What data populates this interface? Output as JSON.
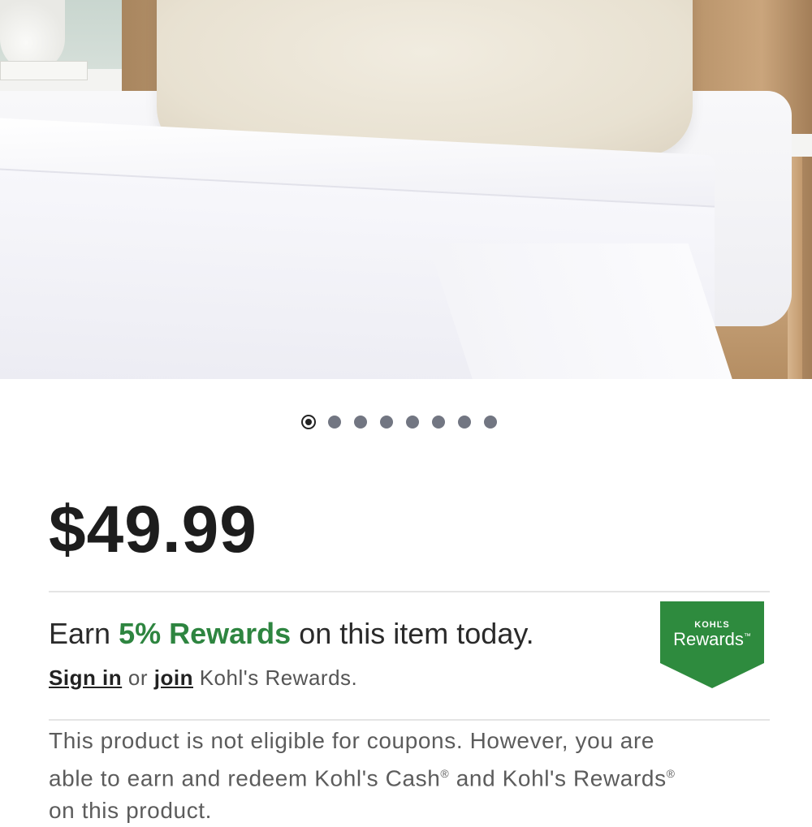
{
  "product": {
    "image_alt": "",
    "carousel": {
      "total": 8,
      "active_index": 0
    }
  },
  "price": {
    "current": "$49.99"
  },
  "rewards": {
    "earn_prefix": "Earn",
    "earn_highlight": "5% Rewards",
    "earn_suffix": "on this item today.",
    "sign_in_label": "Sign in",
    "or_text": "or",
    "join_label": "join",
    "program_text": "Kohl's Rewards.",
    "badge_brand": "KOHĽS",
    "badge_name": "Rewards",
    "badge_tm": "™"
  },
  "coupon_note": {
    "line1": "This product is not eligible for coupons. However, you are",
    "line2_prefix": "able to earn and redeem Kohl's Cash",
    "reg1": "®",
    "line2_mid": " and Kohl's Rewards",
    "reg2": "®",
    "line3": "on this product."
  },
  "colors": {
    "accent_green": "#2e8540",
    "badge_green": "#2e8b3e",
    "text_dark": "#1d1d1d",
    "dot_inactive": "#727682"
  },
  "icons": {
    "carousel_dot": "carousel-dot-icon",
    "rewards_badge": "kohls-rewards-badge-icon"
  }
}
